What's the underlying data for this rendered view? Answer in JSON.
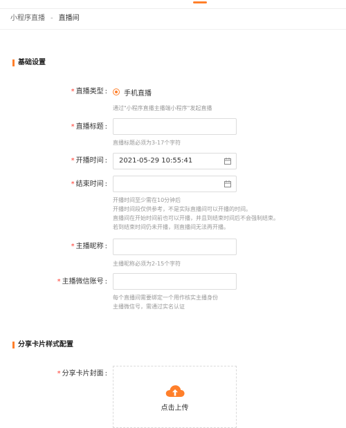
{
  "breadcrumb": {
    "parent": "小程序直播",
    "separator": "-",
    "current": "直播间"
  },
  "sections": {
    "basic": "基础设置",
    "share_card": "分享卡片样式配置"
  },
  "form": {
    "type": {
      "label": "直播类型",
      "option": "手机直播",
      "hint": "通过\"小程序直播主播端小程序\"发起直播"
    },
    "title": {
      "label": "直播标题",
      "value": "",
      "hint": "直播标题必须为3-17个字符"
    },
    "start_time": {
      "label": "开播时间",
      "value": "2021-05-29 10:55:41"
    },
    "end_time": {
      "label": "结束时间",
      "value": "",
      "hints": [
        "开播时间至少需在10分钟后",
        "开播时间段仅供参考，不是实际直播间可以开播的时间。",
        "直播间在开始时间前也可以开播，并且到结束时间后不会强制结束。",
        "若到结束时间仍未开播，则直播间无法再开播。"
      ]
    },
    "anchor_name": {
      "label": "主播昵称",
      "value": "",
      "hint": "主播昵称必须为2-15个字符"
    },
    "anchor_wechat": {
      "label": "主播微信账号",
      "value": "",
      "hints": [
        "每个直播间需要绑定一个用作核实主播身份",
        "主播微信号，需通过实名认证"
      ]
    },
    "cover": {
      "label": "分享卡片封面",
      "upload_text": "点击上传"
    }
  },
  "colors": {
    "accent": "#ff7f2a",
    "required": "#ff3b30"
  },
  "icons": {
    "calendar": "calendar-icon",
    "upload": "cloud-upload-icon"
  }
}
